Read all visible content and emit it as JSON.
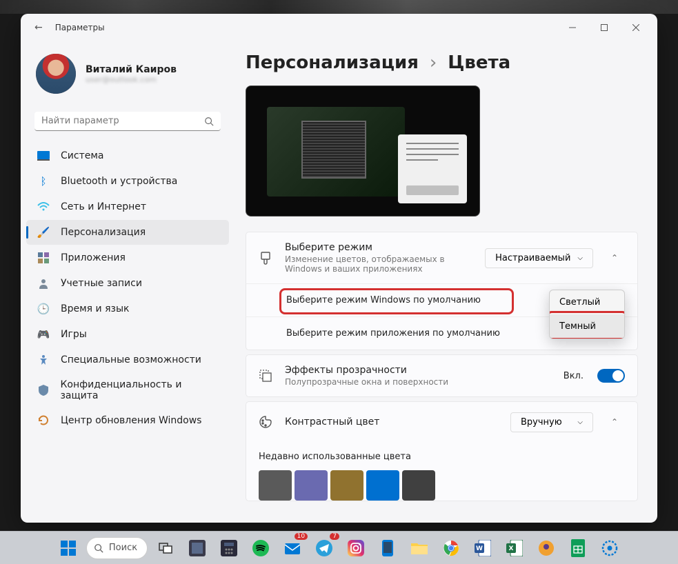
{
  "window": {
    "title": "Параметры"
  },
  "user": {
    "name": "Виталий Каиров",
    "email": "user@outlook.com"
  },
  "search": {
    "placeholder": "Найти параметр"
  },
  "nav": [
    {
      "label": "Система"
    },
    {
      "label": "Bluetooth и устройства"
    },
    {
      "label": "Сеть и Интернет"
    },
    {
      "label": "Персонализация"
    },
    {
      "label": "Приложения"
    },
    {
      "label": "Учетные записи"
    },
    {
      "label": "Время и язык"
    },
    {
      "label": "Игры"
    },
    {
      "label": "Специальные возможности"
    },
    {
      "label": "Конфиденциальность и защита"
    },
    {
      "label": "Центр обновления Windows"
    }
  ],
  "breadcrumb": {
    "parent": "Персонализация",
    "current": "Цвета"
  },
  "mode": {
    "title": "Выберите режим",
    "sub": "Изменение цветов, отображаемых в Windows и ваших приложениях",
    "value": "Настраиваемый",
    "windows_label": "Выберите режим Windows по умолчанию",
    "app_label": "Выберите режим приложения по умолчанию",
    "options": {
      "light": "Светлый",
      "dark": "Темный"
    }
  },
  "transparency": {
    "title": "Эффекты прозрачности",
    "sub": "Полупрозрачные окна и поверхности",
    "state": "Вкл."
  },
  "accent": {
    "title": "Контрастный цвет",
    "value": "Вручную",
    "recent_title": "Недавно использованные цвета"
  },
  "recent_colors": [
    "#5a5a5a",
    "#6a6ab0",
    "#90722f",
    "#0070d0",
    "#404040"
  ],
  "taskbar": {
    "search": "Поиск"
  }
}
